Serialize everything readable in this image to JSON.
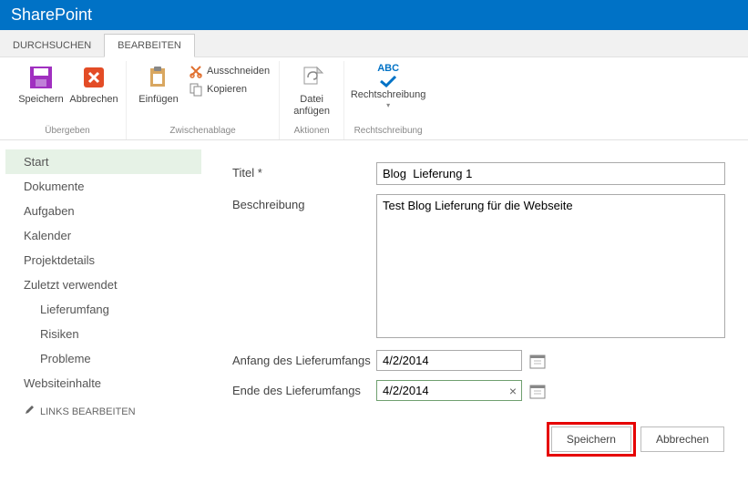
{
  "header": {
    "title": "SharePoint"
  },
  "tabs": {
    "browse": "DURCHSUCHEN",
    "edit": "BEARBEITEN"
  },
  "ribbon": {
    "save": "Speichern",
    "cancel": "Abbrechen",
    "paste": "Einfügen",
    "cut": "Ausschneiden",
    "copy": "Kopieren",
    "attach": "Datei anfügen",
    "spellcheck": "Rechtschreibung",
    "group_commit": "Übergeben",
    "group_clipboard": "Zwischenablage",
    "group_actions": "Aktionen",
    "group_spell": "Rechtschreibung",
    "abc_label": "ABC"
  },
  "nav": {
    "items": [
      {
        "label": "Start"
      },
      {
        "label": "Dokumente"
      },
      {
        "label": "Aufgaben"
      },
      {
        "label": "Kalender"
      },
      {
        "label": "Projektdetails"
      },
      {
        "label": "Zuletzt verwendet"
      }
    ],
    "subitems": [
      {
        "label": "Lieferumfang"
      },
      {
        "label": "Risiken"
      },
      {
        "label": "Probleme"
      }
    ],
    "site_contents": "Websiteinhalte",
    "edit_links": "LINKS BEARBEITEN"
  },
  "form": {
    "title_label": "Titel",
    "title_required": "*",
    "title_value": "Blog  Lieferung 1",
    "description_label": "Beschreibung",
    "description_value": "Test Blog Lieferung für die Webseite",
    "start_label": "Anfang des Lieferumfangs",
    "start_value": "4/2/2014",
    "end_label": "Ende des Lieferumfangs",
    "end_value": "4/2/2014"
  },
  "buttons": {
    "save": "Speichern",
    "cancel": "Abbrechen"
  }
}
